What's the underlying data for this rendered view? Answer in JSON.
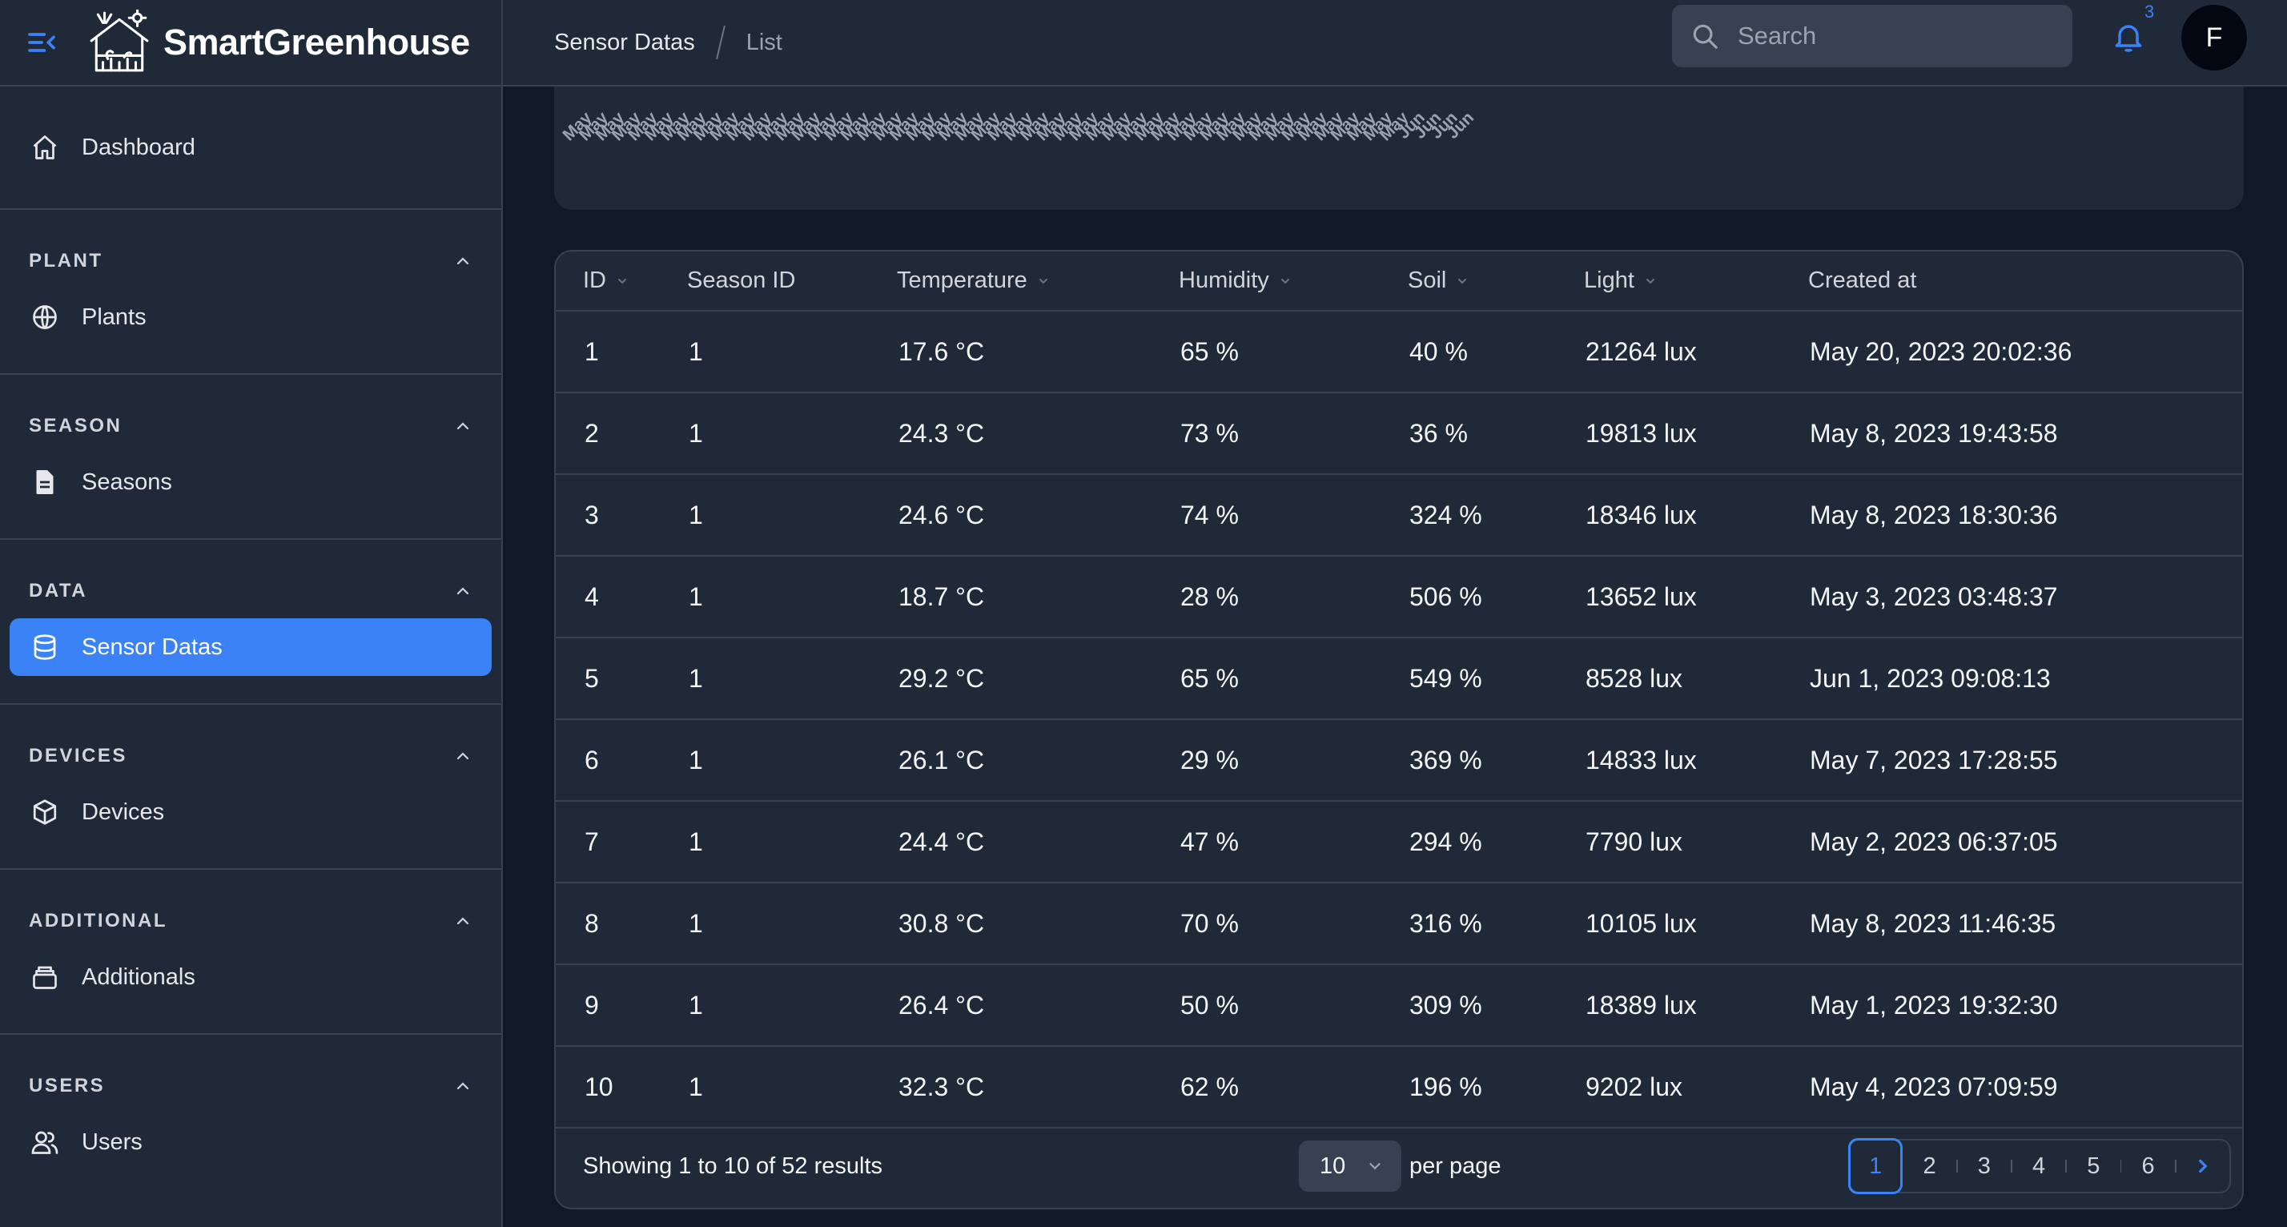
{
  "app": {
    "name": "SmartGreenhouse"
  },
  "topbar": {
    "breadcrumbs": [
      "Sensor Datas",
      "List"
    ],
    "search_placeholder": "Search",
    "notification_count": "3",
    "avatar_initial": "F"
  },
  "sidebar": {
    "dashboard": "Dashboard",
    "groups": [
      {
        "title": "PLANT",
        "items": [
          {
            "label": "Plants",
            "icon": "globe-icon"
          }
        ]
      },
      {
        "title": "SEASON",
        "items": [
          {
            "label": "Seasons",
            "icon": "document-icon"
          }
        ]
      },
      {
        "title": "DATA",
        "items": [
          {
            "label": "Sensor Datas",
            "icon": "database-icon",
            "active": true
          }
        ]
      },
      {
        "title": "DEVICES",
        "items": [
          {
            "label": "Devices",
            "icon": "cube-icon"
          }
        ]
      },
      {
        "title": "ADDITIONAL",
        "items": [
          {
            "label": "Additionals",
            "icon": "archive-icon"
          }
        ]
      },
      {
        "title": "USERS",
        "items": [
          {
            "label": "Users",
            "icon": "users-icon"
          }
        ]
      }
    ]
  },
  "chart_strip": {
    "tick_label_month": "May",
    "tick_label_month_last": "Jun"
  },
  "table": {
    "headers": [
      "ID",
      "Season ID",
      "Temperature",
      "Humidity",
      "Soil",
      "Light",
      "Created at"
    ],
    "rows": [
      [
        "1",
        "1",
        "17.6 °C",
        "65 %",
        "40 %",
        "21264 lux",
        "May 20, 2023 20:02:36"
      ],
      [
        "2",
        "1",
        "24.3 °C",
        "73 %",
        "36 %",
        "19813 lux",
        "May 8, 2023 19:43:58"
      ],
      [
        "3",
        "1",
        "24.6 °C",
        "74 %",
        "324 %",
        "18346 lux",
        "May 8, 2023 18:30:36"
      ],
      [
        "4",
        "1",
        "18.7 °C",
        "28 %",
        "506 %",
        "13652 lux",
        "May 3, 2023 03:48:37"
      ],
      [
        "5",
        "1",
        "29.2 °C",
        "65 %",
        "549 %",
        "8528 lux",
        "Jun 1, 2023 09:08:13"
      ],
      [
        "6",
        "1",
        "26.1 °C",
        "29 %",
        "369 %",
        "14833 lux",
        "May 7, 2023 17:28:55"
      ],
      [
        "7",
        "1",
        "24.4 °C",
        "47 %",
        "294 %",
        "7790 lux",
        "May 2, 2023 06:37:05"
      ],
      [
        "8",
        "1",
        "30.8 °C",
        "70 %",
        "316 %",
        "10105 lux",
        "May 8, 2023 11:46:35"
      ],
      [
        "9",
        "1",
        "26.4 °C",
        "50 %",
        "309 %",
        "18389 lux",
        "May 1, 2023 19:32:30"
      ],
      [
        "10",
        "1",
        "32.3 °C",
        "62 %",
        "196 %",
        "9202 lux",
        "May 4, 2023 07:09:59"
      ]
    ],
    "footer": {
      "showing": "Showing 1 to 10 of 52 results",
      "per_page_value": "10",
      "per_page_label": "per page",
      "pages": [
        "1",
        "2",
        "3",
        "4",
        "5",
        "6"
      ],
      "current_page": "1"
    }
  },
  "colors": {
    "background": "#111827",
    "panel": "#1f2937",
    "accent": "#3b82f6",
    "border": "#374151"
  }
}
